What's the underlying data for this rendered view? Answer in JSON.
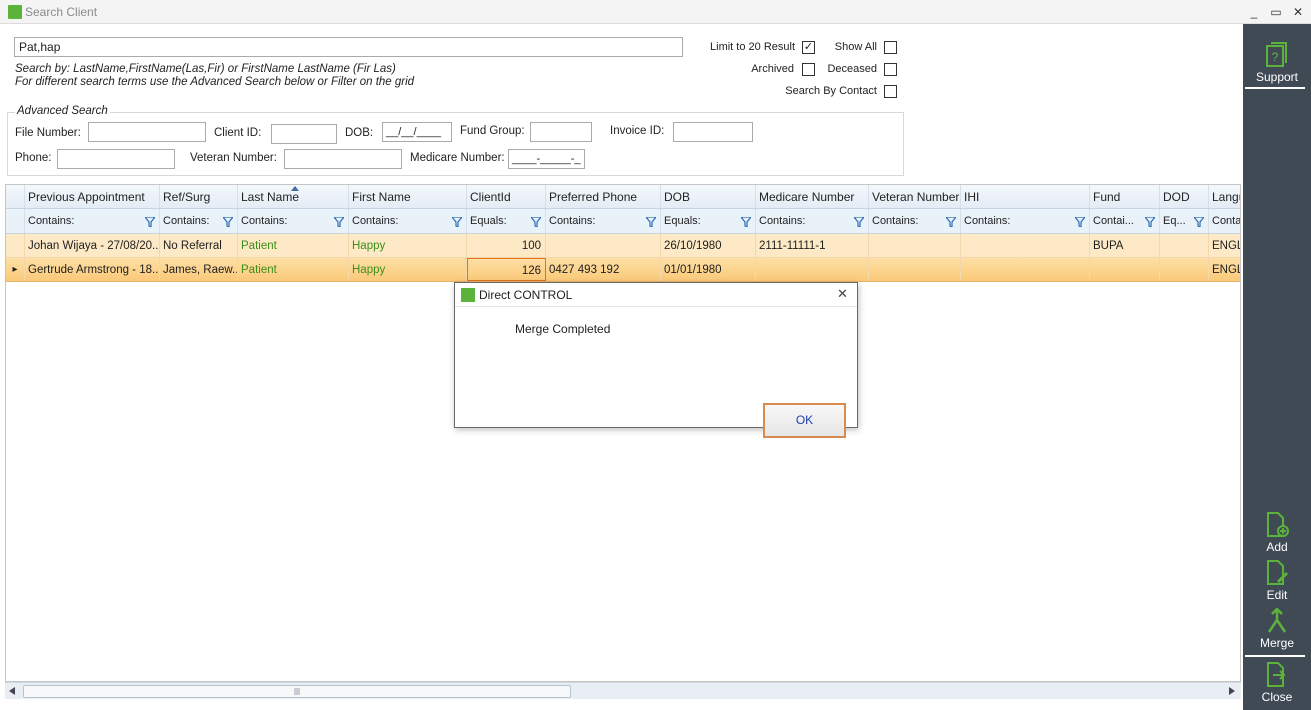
{
  "window": {
    "title": "Search Client",
    "controls": [
      "_",
      "▭",
      "✕"
    ]
  },
  "search": {
    "value": "Pat,hap",
    "hint1": "Search by: LastName,FirstName(Las,Fir) or FirstName LastName (Fir Las)",
    "hint2": "For different search terms use the Advanced Search below or Filter on the grid"
  },
  "options": {
    "limit_label": "Limit to 20 Result",
    "limit_checked": true,
    "show_all_label": "Show All",
    "archived_label": "Archived",
    "deceased_label": "Deceased",
    "search_by_contact_label": "Search By Contact"
  },
  "advanced": {
    "legend": "Advanced Search",
    "file_number_label": "File Number:",
    "client_id_label": "Client ID:",
    "dob_label": "DOB:",
    "dob_mask": "__/__/____",
    "fund_group_label": "Fund Group:",
    "invoice_id_label": "Invoice ID:",
    "phone_label": "Phone:",
    "veteran_number_label": "Veteran Number:",
    "medicare_number_label": "Medicare Number:",
    "medicare_mask": "____-_____-_"
  },
  "grid": {
    "columns": [
      "Previous Appointment",
      "Ref/Surg",
      "Last Name",
      "First Name",
      "ClientId",
      "Preferred Phone",
      "DOB",
      "Medicare Number",
      "Veteran Number",
      "IHI",
      "Fund",
      "DOD",
      "Langu"
    ],
    "filters": [
      "Contains:",
      "Contains:",
      "Contains:",
      "Contains:",
      "Equals:",
      "Contains:",
      "Equals:",
      "Contains:",
      "Contains:",
      "Contains:",
      "Contai...",
      "Eq...",
      "Conta"
    ],
    "rows": [
      [
        "Johan Wijaya - 27/08/20...",
        "No Referral",
        "Patient",
        "Happy",
        "100",
        "",
        "26/10/1980",
        "2111-11111-1",
        "",
        "",
        "BUPA",
        "",
        "ENGL"
      ],
      [
        "Gertrude Armstrong - 18...",
        "James, Raew...",
        "Patient",
        "Happy",
        "126",
        "0427 493 192",
        "01/01/1980",
        "",
        "",
        "",
        "",
        "",
        "ENGL"
      ]
    ],
    "current_row_indicator": "▸"
  },
  "sidebar": {
    "support": "Support",
    "add": "Add",
    "edit": "Edit",
    "merge": "Merge",
    "close": "Close"
  },
  "dialog": {
    "title": "Direct CONTROL",
    "message": "Merge Completed",
    "ok": "OK",
    "close_glyph": "✕"
  },
  "colors": {
    "accent_green": "#5cb33b",
    "sidebar_bg": "#3f4a55",
    "selected_row": "#fbc978",
    "row_highlight": "#fde9c5",
    "text_green": "#3c8f1a"
  }
}
